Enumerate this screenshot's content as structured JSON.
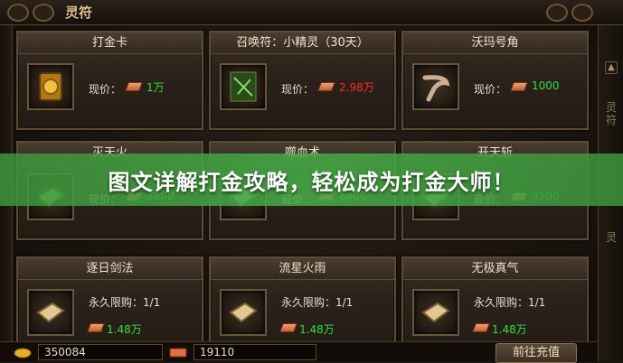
{
  "window": {
    "title": "灵符"
  },
  "banner": {
    "text": "图文详解打金攻略，轻松成为打金大师！"
  },
  "price_label": "现价：",
  "limit_label": "永久限购：1/1",
  "cards": [
    {
      "title": "打金卡",
      "price": "1万",
      "price_color": "#30e040",
      "icon": "gold-card-icon"
    },
    {
      "title": "召唤符：小精灵（30天）",
      "price": "2.98万",
      "price_color": "#ff2a20",
      "icon": "summon-talisman-icon"
    },
    {
      "title": "沃玛号角",
      "price": "1000",
      "price_color": "#30e040",
      "icon": "horn-icon"
    },
    {
      "title": "灭天火",
      "price": "8800",
      "price_color": "#30e040",
      "icon": "skill-book-icon"
    },
    {
      "title": "噬血术",
      "price": "8800",
      "price_color": "#30e040",
      "icon": "skill-book-icon"
    },
    {
      "title": "开天斩",
      "price": "9500",
      "price_color": "#30e040",
      "icon": "skill-book-icon"
    },
    {
      "title": "逐日剑法",
      "price": "1.48万",
      "price_color": "#30e040",
      "icon": "skill-book-icon"
    },
    {
      "title": "流星火雨",
      "price": "1.48万",
      "price_color": "#30e040",
      "icon": "skill-book-icon"
    },
    {
      "title": "无极真气",
      "price": "1.48万",
      "price_color": "#30e040",
      "icon": "skill-book-icon"
    }
  ],
  "currency": {
    "gold": "350084",
    "ingot": "19110"
  },
  "goto_button": "前往充值",
  "side": {
    "text1": "灵符",
    "text2": "灵"
  }
}
